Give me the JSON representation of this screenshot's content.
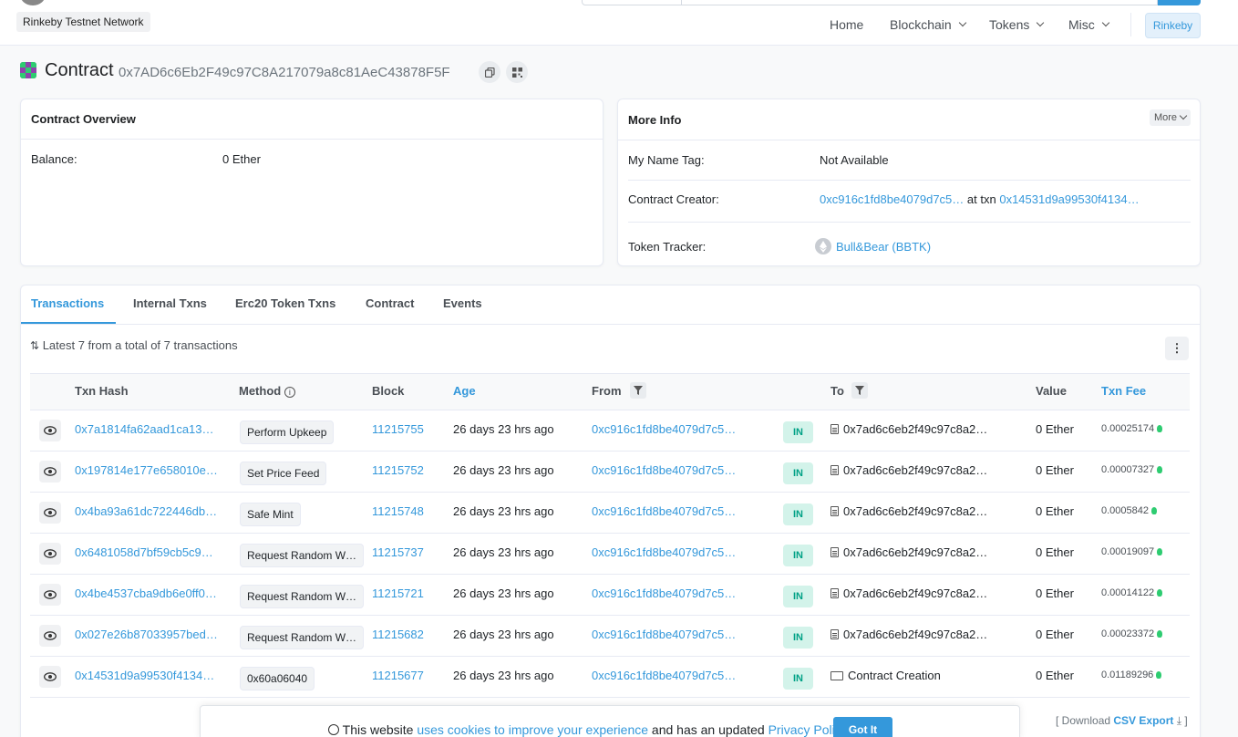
{
  "header": {
    "network_label": "Rinkeby Testnet Network",
    "nav": [
      "Home",
      "Blockchain",
      "Tokens",
      "Misc"
    ],
    "network_badge": "Rinkeby"
  },
  "title": {
    "label": "Contract",
    "address": "0x7AD6c6Eb2F49c97C8A217079a8c81AeC43878F5F"
  },
  "overview": {
    "heading": "Contract Overview",
    "balance_label": "Balance:",
    "balance_value": "0 Ether"
  },
  "more_info": {
    "heading": "More Info",
    "more_button": "More",
    "name_tag_label": "My Name Tag:",
    "name_tag_value": "Not Available",
    "creator_label": "Contract Creator:",
    "creator_address": "0xc916c1fd8be4079d7c5…",
    "creator_at": "at txn",
    "creator_txn": "0x14531d9a99530f4134…",
    "token_label": "Token Tracker:",
    "token_value": "Bull&Bear (BBTK)"
  },
  "tabs": [
    "Transactions",
    "Internal Txns",
    "Erc20 Token Txns",
    "Contract",
    "Events"
  ],
  "summary": "Latest 7 from a total of 7 transactions",
  "table": {
    "headers": [
      "Txn Hash",
      "Method",
      "Block",
      "Age",
      "From",
      "To",
      "Value",
      "Txn Fee"
    ],
    "rows": [
      {
        "hash": "0x7a1814fa62aad1ca13…",
        "method": "Perform Upkeep",
        "block": "11215755",
        "age": "26 days 23 hrs ago",
        "from": "0xc916c1fd8be4079d7c5…",
        "dir": "IN",
        "to": "0x7ad6c6eb2f49c97c8a2…",
        "value": "0 Ether",
        "fee": "0.00025174"
      },
      {
        "hash": "0x197814e177e658010e…",
        "method": "Set Price Feed",
        "block": "11215752",
        "age": "26 days 23 hrs ago",
        "from": "0xc916c1fd8be4079d7c5…",
        "dir": "IN",
        "to": "0x7ad6c6eb2f49c97c8a2…",
        "value": "0 Ether",
        "fee": "0.00007327"
      },
      {
        "hash": "0x4ba93a61dc722446db…",
        "method": "Safe Mint",
        "block": "11215748",
        "age": "26 days 23 hrs ago",
        "from": "0xc916c1fd8be4079d7c5…",
        "dir": "IN",
        "to": "0x7ad6c6eb2f49c97c8a2…",
        "value": "0 Ether",
        "fee": "0.0005842"
      },
      {
        "hash": "0x6481058d7bf59cb5c9…",
        "method": "Request Random W…",
        "block": "11215737",
        "age": "26 days 23 hrs ago",
        "from": "0xc916c1fd8be4079d7c5…",
        "dir": "IN",
        "to": "0x7ad6c6eb2f49c97c8a2…",
        "value": "0 Ether",
        "fee": "0.00019097"
      },
      {
        "hash": "0x4be4537cba9db6e0ff0…",
        "method": "Request Random W…",
        "block": "11215721",
        "age": "26 days 23 hrs ago",
        "from": "0xc916c1fd8be4079d7c5…",
        "dir": "IN",
        "to": "0x7ad6c6eb2f49c97c8a2…",
        "value": "0 Ether",
        "fee": "0.00014122"
      },
      {
        "hash": "0x027e26b87033957bed…",
        "method": "Request Random W…",
        "block": "11215682",
        "age": "26 days 23 hrs ago",
        "from": "0xc916c1fd8be4079d7c5…",
        "dir": "IN",
        "to": "0x7ad6c6eb2f49c97c8a2…",
        "value": "0 Ether",
        "fee": "0.00023372"
      },
      {
        "hash": "0x14531d9a99530f4134…",
        "method": "0x60a06040",
        "block": "11215677",
        "age": "26 days 23 hrs ago",
        "from": "0xc916c1fd8be4079d7c5…",
        "dir": "IN",
        "to": "Contract Creation",
        "to_type": "creation",
        "value": "0 Ether",
        "fee": "0.01189296"
      }
    ]
  },
  "cookie": {
    "text_before": "This website",
    "link1": "uses cookies to improve your experience",
    "text_middle": "and has an updated",
    "link2": "Privacy Policy.",
    "button": "Got It"
  },
  "download": {
    "prefix": "[ Download",
    "link": "CSV Export",
    "suffix": "]"
  },
  "colors": {
    "accent": "#3498db",
    "in_badge_bg": "#d3f3ea",
    "in_badge_text": "#00a186"
  }
}
